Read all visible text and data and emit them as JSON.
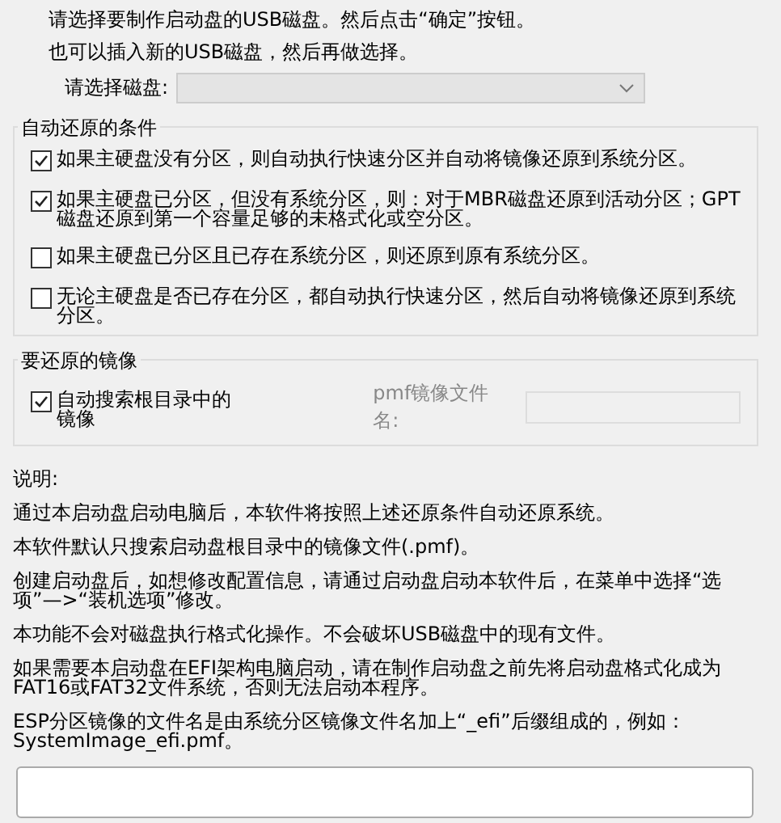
{
  "intro": [
    "请选择要制作启动盘的USB磁盘。然后点击“确定”按钮。",
    "也可以插入新的USB磁盘，然后再做选择。"
  ],
  "disk_select": {
    "label": "请选择磁盘:",
    "disabled": true
  },
  "restore_conditions": {
    "title": "自动还原的条件",
    "options": [
      {
        "label": "如果主硬盘没有分区，则自动执行快速分区并自动将镜像还原到系统分区。",
        "checked": true
      },
      {
        "label": "如果主硬盘已分区，但没有系统分区，则：对于MBR磁盘还原到活动分区；GPT磁盘还原到第一个容量足够的未格式化或空分区。",
        "checked": true
      },
      {
        "label": "如果主硬盘已分区且已存在系统分区，则还原到原有系统分区。",
        "checked": false
      },
      {
        "label": "无论主硬盘是否已存在分区，都自动执行快速分区，然后自动将镜像还原到系统分区。",
        "checked": false
      }
    ]
  },
  "image_to_restore": {
    "title": "要还原的镜像",
    "auto_search": {
      "label": "自动搜索根目录中的镜像",
      "checked": true
    },
    "filename_field": {
      "label": "pmf镜像文件名:",
      "disabled": true
    }
  },
  "notes": {
    "title": "说明:",
    "paragraphs": [
      "通过本启动盘启动电脑后，本软件将按照上述还原条件自动还原系统。",
      "本软件默认只搜索启动盘根目录中的镜像文件(.pmf)。",
      "创建启动盘后，如想修改配置信息，请通过启动盘启动本软件后，在菜单中选择“选项”—>“装机选项”修改。",
      "本功能不会对磁盘执行格式化操作。不会破坏USB磁盘中的现有文件。",
      "如果需要本启动盘在EFI架构电脑启动，请在制作启动盘之前先将启动盘格式化成为FAT16或FAT32文件系统，否则无法启动本程序。",
      "ESP分区镜像的文件名是由系统分区镜像文件名加上“_efi”后缀组成的，例如：SystemImage_efi.pmf。"
    ]
  }
}
